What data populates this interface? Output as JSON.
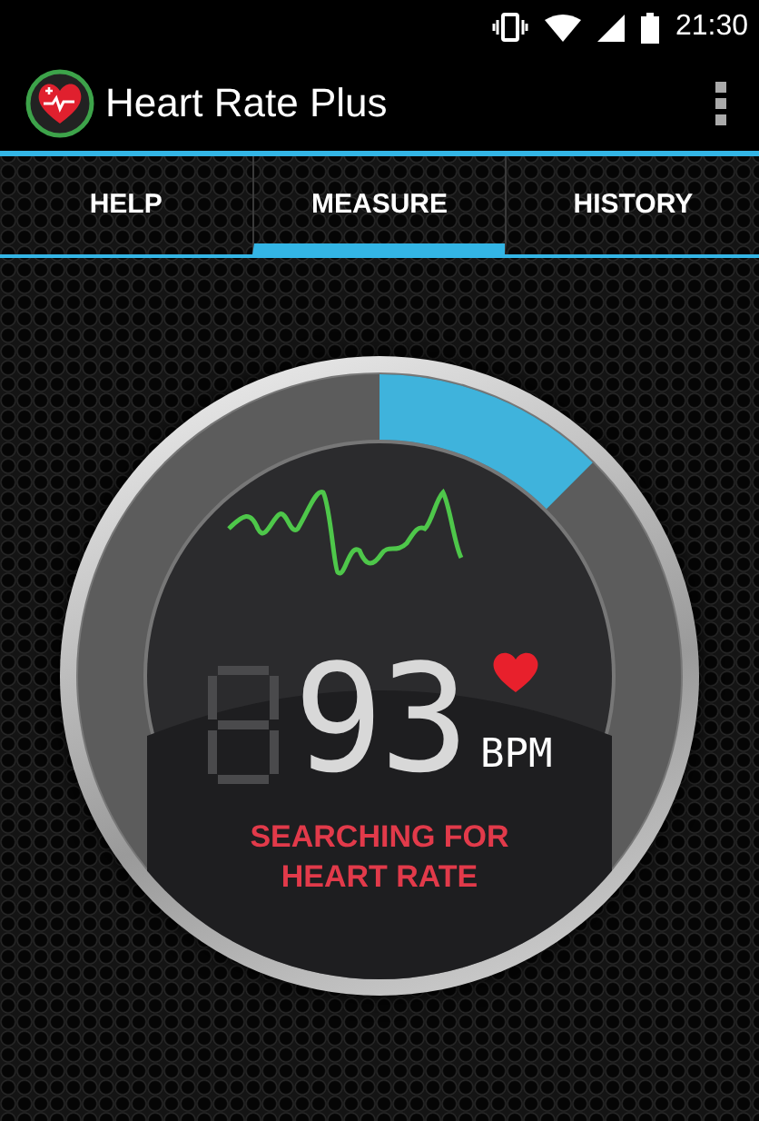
{
  "status_bar": {
    "time": "21:30"
  },
  "app_bar": {
    "title": "Heart Rate Plus"
  },
  "tabs": [
    {
      "label": "HELP",
      "selected": false
    },
    {
      "label": "MEASURE",
      "selected": true
    },
    {
      "label": "HISTORY",
      "selected": false
    }
  ],
  "measure": {
    "progress": {
      "level": 0.125
    },
    "reading": "93",
    "unit": "BPM",
    "status": "SEARCHING FOR\nHEART RATE"
  }
}
